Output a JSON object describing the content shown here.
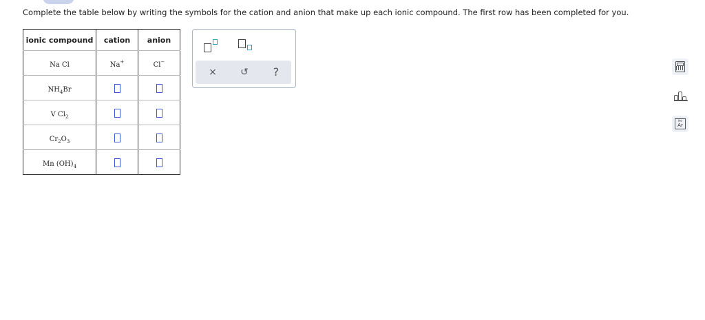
{
  "instructions": "Complete the table below by writing the symbols for the cation and anion that make up each ionic compound. The first row has been completed for you.",
  "table": {
    "headers": [
      "ionic compound",
      "cation",
      "anion"
    ],
    "rows": [
      {
        "compound": {
          "p1": "Na Cl"
        },
        "cation": {
          "symbol": "Na",
          "charge": "+"
        },
        "anion": {
          "symbol": "Cl",
          "charge": "−"
        }
      },
      {
        "compound": {
          "p1": "NH",
          "s1": "4",
          "p2": "Br"
        }
      },
      {
        "compound": {
          "p1": "V Cl",
          "s1": "2"
        }
      },
      {
        "compound": {
          "p1": "Cr",
          "s1": "2",
          "p2": "O",
          "s2": "3"
        }
      },
      {
        "compound": {
          "p1": "Mn (OH)",
          "s1": "4"
        }
      }
    ]
  },
  "palette": {
    "clear": "×",
    "undo": "↺",
    "help": "?"
  },
  "tools": {
    "ptable_small": "He",
    "ptable_label": "Ar"
  },
  "colors": {
    "answer_box": "#3b5bdb",
    "template_small": "#29a3c8",
    "palette_border": "#a9b6c6"
  }
}
